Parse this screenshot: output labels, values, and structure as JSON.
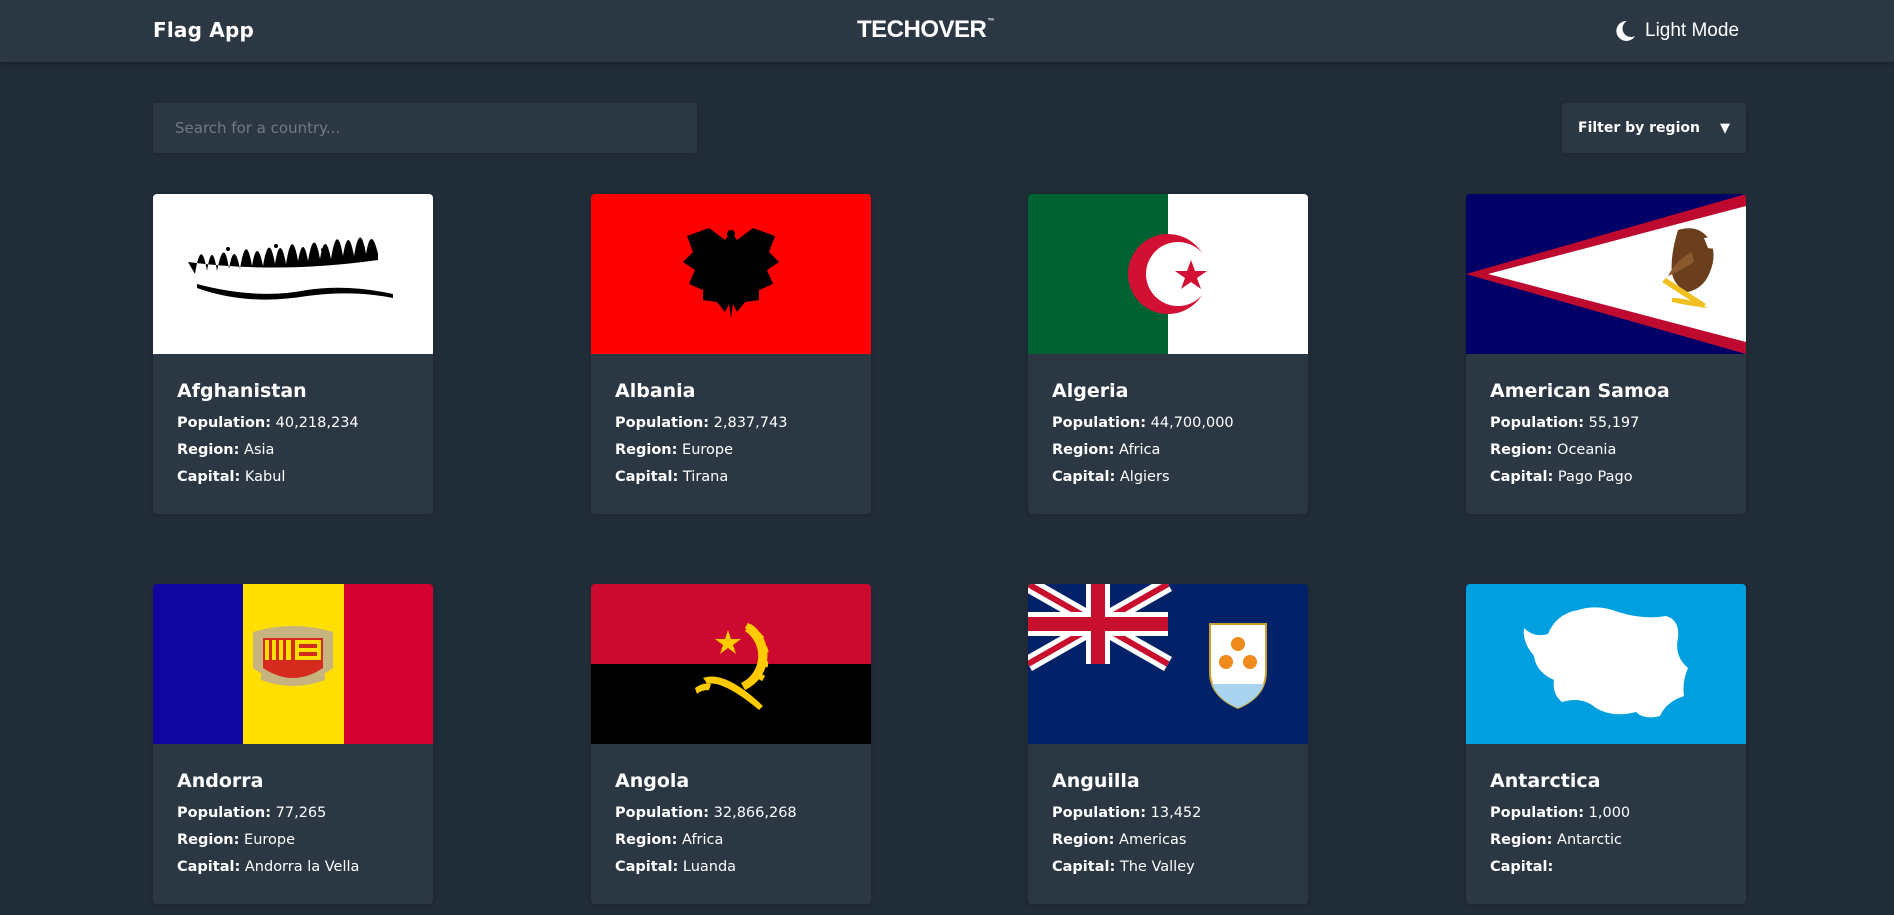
{
  "header": {
    "app_title": "Flag App",
    "logo_text": "TECHOVER",
    "logo_mark": "™",
    "mode_label": "Light Mode",
    "mode_icon": "moon-icon"
  },
  "search": {
    "placeholder": "Search for a country...",
    "value": ""
  },
  "filter": {
    "label": "Filter by region",
    "caret": "▼"
  },
  "labels": {
    "population": "Population:",
    "region": "Region:",
    "capital": "Capital:"
  },
  "countries": [
    {
      "name": "Afghanistan",
      "population": "40,218,234",
      "region": "Asia",
      "capital": "Kabul"
    },
    {
      "name": "Albania",
      "population": "2,837,743",
      "region": "Europe",
      "capital": "Tirana"
    },
    {
      "name": "Algeria",
      "population": "44,700,000",
      "region": "Africa",
      "capital": "Algiers"
    },
    {
      "name": "American Samoa",
      "population": "55,197",
      "region": "Oceania",
      "capital": "Pago Pago"
    },
    {
      "name": "Andorra",
      "population": "77,265",
      "region": "Europe",
      "capital": "Andorra la Vella"
    },
    {
      "name": "Angola",
      "population": "32,866,268",
      "region": "Africa",
      "capital": "Luanda"
    },
    {
      "name": "Anguilla",
      "population": "13,452",
      "region": "Americas",
      "capital": "The Valley"
    },
    {
      "name": "Antarctica",
      "population": "1,000",
      "region": "Antarctic",
      "capital": ""
    }
  ],
  "colors": {
    "background": "#202c37",
    "element": "#2b3743",
    "text": "#ffffff"
  }
}
